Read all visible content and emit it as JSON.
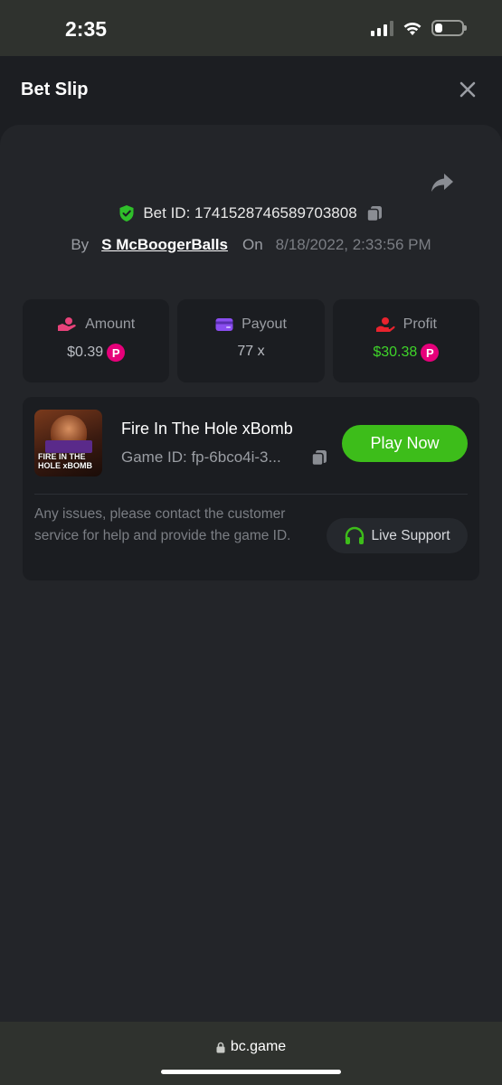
{
  "status_bar": {
    "time": "2:35",
    "battery_percent": 30
  },
  "header": {
    "title": "Bet Slip"
  },
  "bet": {
    "id_label": "Bet ID: 1741528746589703808",
    "by_label": "By",
    "user": "S McBoogerBalls",
    "on_label": "On",
    "date": "8/18/2022, 2:33:56 PM"
  },
  "stats": {
    "amount": {
      "label": "Amount",
      "value": "$0.39"
    },
    "payout": {
      "label": "Payout",
      "value": "77 x"
    },
    "profit": {
      "label": "Profit",
      "value": "$30.38"
    }
  },
  "game": {
    "title": "Fire In The Hole xBomb",
    "id": "Game ID: fp-6bco4i-3...",
    "thumb_text_line1": "FIRE IN THE",
    "thumb_text_line2": "HOLE xBOMB",
    "play_label": "Play Now",
    "issue_text": "Any issues, please contact the customer service for help and provide the game ID.",
    "support_label": "Live Support"
  },
  "browser": {
    "url": "bc.game"
  },
  "colors": {
    "accent_green": "#3dbd1a",
    "profit_green": "#3fd42a",
    "coin_pink": "#e6007a",
    "amount_icon": "#e8427a",
    "payout_icon": "#8a4df0",
    "profit_icon": "#e8232e"
  },
  "icons": [
    "shield-icon",
    "copy-icon",
    "share-icon",
    "close-icon",
    "headset-icon",
    "lock-icon",
    "wifi-icon",
    "signal-icon",
    "battery-icon"
  ]
}
